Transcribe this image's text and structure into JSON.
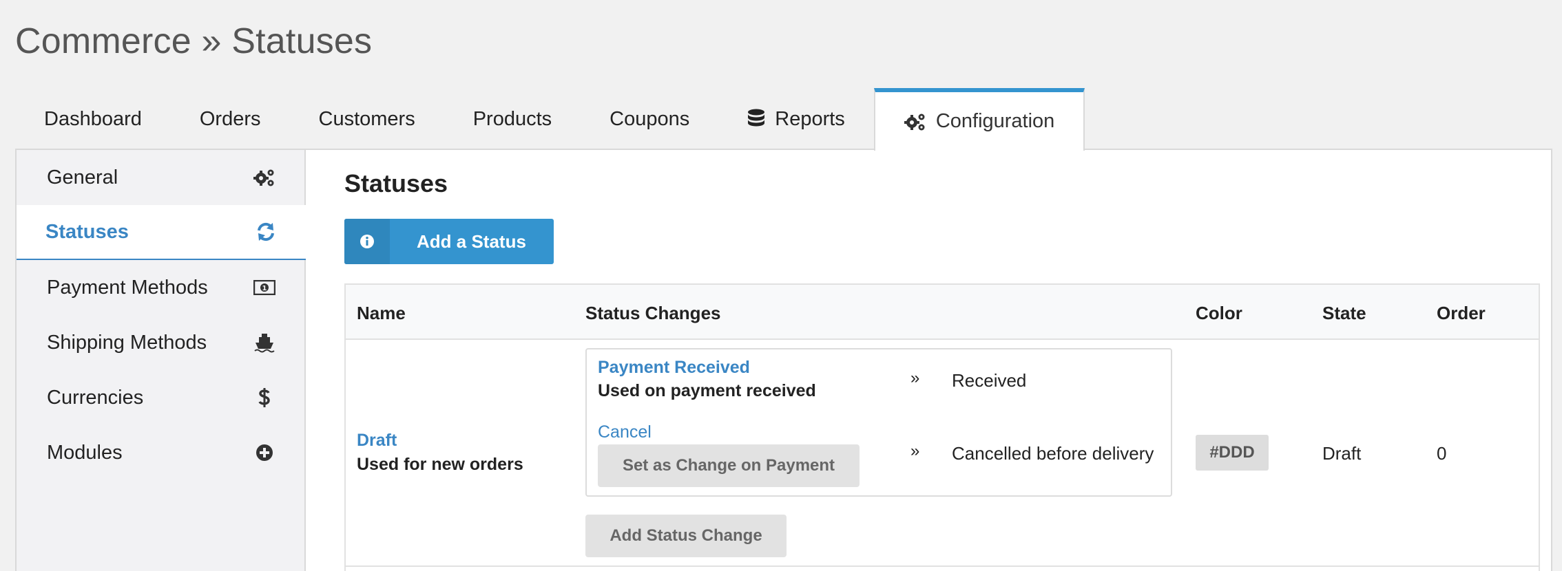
{
  "page": {
    "title": "Commerce » Statuses"
  },
  "tabs": [
    {
      "label": "Dashboard"
    },
    {
      "label": "Orders"
    },
    {
      "label": "Customers"
    },
    {
      "label": "Products"
    },
    {
      "label": "Coupons"
    },
    {
      "label": "Reports",
      "icon": "database-icon"
    },
    {
      "label": "Configuration",
      "icon": "gears-icon",
      "active": true
    }
  ],
  "sidebar": {
    "items": [
      {
        "label": "General",
        "icon": "gears-icon"
      },
      {
        "label": "Statuses",
        "icon": "refresh-icon",
        "active": true
      },
      {
        "label": "Payment Methods",
        "icon": "money-icon"
      },
      {
        "label": "Shipping Methods",
        "icon": "ship-icon"
      },
      {
        "label": "Currencies",
        "icon": "dollar-icon"
      },
      {
        "label": "Modules",
        "icon": "plus-circle-icon"
      }
    ]
  },
  "main": {
    "title": "Statuses",
    "add_button": {
      "label": "Add a Status",
      "icon": "info-icon"
    },
    "table": {
      "headers": [
        "Name",
        "Status Changes",
        "Color",
        "State",
        "Order"
      ],
      "rows": [
        {
          "name": "Draft",
          "description": "Used for new orders",
          "changes": [
            {
              "link": "Payment Received",
              "description": "Used on payment received",
              "target": "Received"
            },
            {
              "link": "Cancel",
              "button": "Set as Change on Payment",
              "target": "Cancelled before delivery"
            }
          ],
          "add_change_label": "Add Status Change",
          "arrow": "»",
          "color": "#DDD",
          "state": "Draft",
          "order": "0"
        }
      ]
    }
  },
  "colors": {
    "accent": "#3494cf",
    "link": "#3a86c4",
    "badge": "#dddddd"
  }
}
